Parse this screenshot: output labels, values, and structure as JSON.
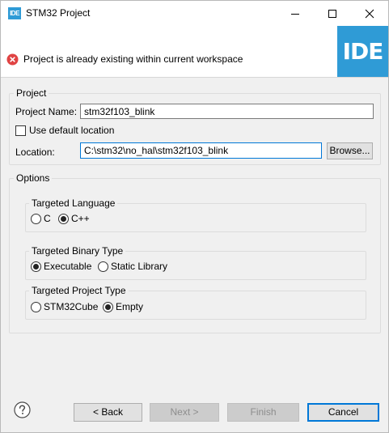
{
  "window": {
    "title": "STM32 Project",
    "app_icon_text": "IDE"
  },
  "header": {
    "message": "Project is already existing within current workspace",
    "logo_text": "IDE"
  },
  "project": {
    "group_title": "Project",
    "name_label": "Project Name:",
    "name_value": "stm32f103_blink",
    "use_default_location_label": "Use default location",
    "use_default_location_checked": false,
    "location_label": "Location:",
    "location_value": "C:\\stm32\\no_hal\\stm32f103_blink",
    "browse_label": "Browse..."
  },
  "options": {
    "group_title": "Options",
    "language": {
      "title": "Targeted Language",
      "options": [
        "C",
        "C++"
      ],
      "selected": "C++"
    },
    "binary_type": {
      "title": "Targeted Binary Type",
      "options": [
        "Executable",
        "Static Library"
      ],
      "selected": "Executable"
    },
    "project_type": {
      "title": "Targeted Project Type",
      "options": [
        "STM32Cube",
        "Empty"
      ],
      "selected": "Empty"
    }
  },
  "footer": {
    "back_label": "< Back",
    "next_label": "Next >",
    "finish_label": "Finish",
    "cancel_label": "Cancel"
  },
  "colors": {
    "accent": "#2f9bd6",
    "error": "#e04343",
    "focus": "#0078d7"
  }
}
